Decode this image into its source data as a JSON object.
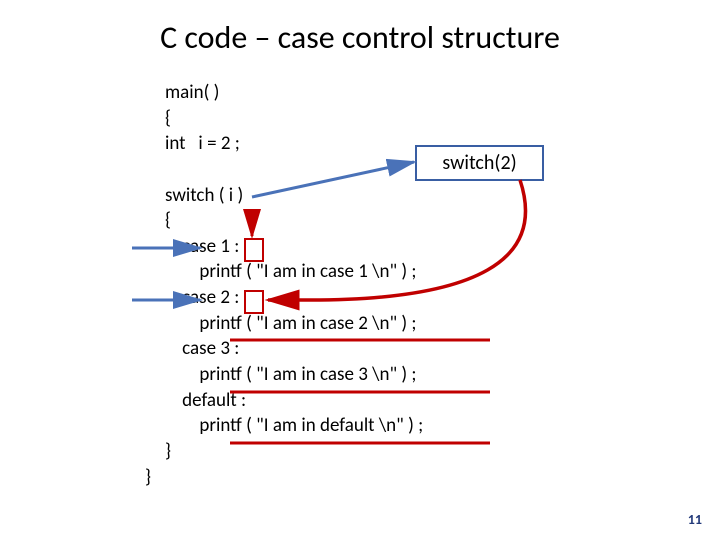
{
  "title": "C code – case control structure",
  "callout": "switch(2)",
  "code_lines": {
    "l0": "main( )",
    "l1": "{",
    "l2": "int   i = 2 ;",
    "l3": "",
    "l4": "switch ( i )",
    "l5": "{",
    "l6": "    case 1 :",
    "l7": "        printf ( \"I am in case 1 \\n\" ) ;",
    "l8": "    case 2 :",
    "l9": "        printf ( \"I am in case 2 \\n\" ) ;",
    "l10": "    case 3 :",
    "l11": "        printf ( \"I am in case 3 \\n\" ) ;",
    "l12": "    default :",
    "l13": "        printf ( \"I am in default \\n\" ) ;",
    "l14": "}",
    "l15_close": "}"
  },
  "page_number": "11"
}
